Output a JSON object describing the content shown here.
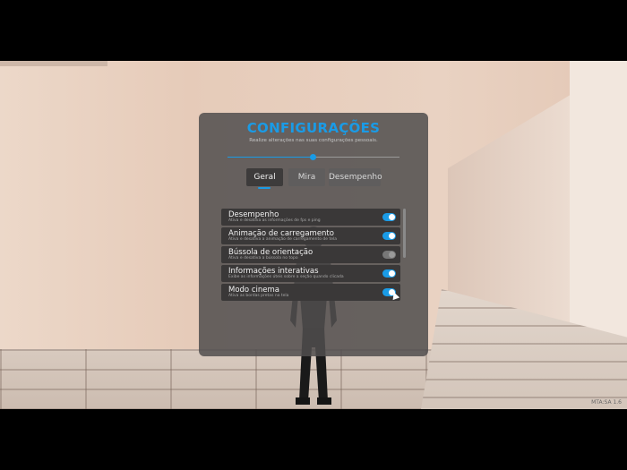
{
  "settings": {
    "title": "CONFIGURAÇÕES",
    "subtitle": "Realize alterações nas suas configurações pessoais.",
    "slider_value": 0.5,
    "tabs": [
      {
        "label": "Geral",
        "active": true
      },
      {
        "label": "Mira",
        "active": false
      },
      {
        "label": "Desempenho",
        "active": false
      }
    ],
    "items": [
      {
        "label": "Desempenho",
        "description": "Ativa e desativa as informações de fps e ping",
        "enabled": true
      },
      {
        "label": "Animação de carregamento",
        "description": "Ativa e desativa a animação de carregamento de tela",
        "enabled": true
      },
      {
        "label": "Bússola de orientação",
        "description": "Ativa e desativa a bússola no topo",
        "enabled": false
      },
      {
        "label": "Informações interativas",
        "description": "Exibe as informações úteis sobre a seção quando clicada",
        "enabled": true
      },
      {
        "label": "Modo cinema",
        "description": "Ativa as bordas pretas na tela",
        "enabled": true
      }
    ],
    "accent_color": "#1a9be6"
  },
  "watermark": "MTA:SA 1.6"
}
